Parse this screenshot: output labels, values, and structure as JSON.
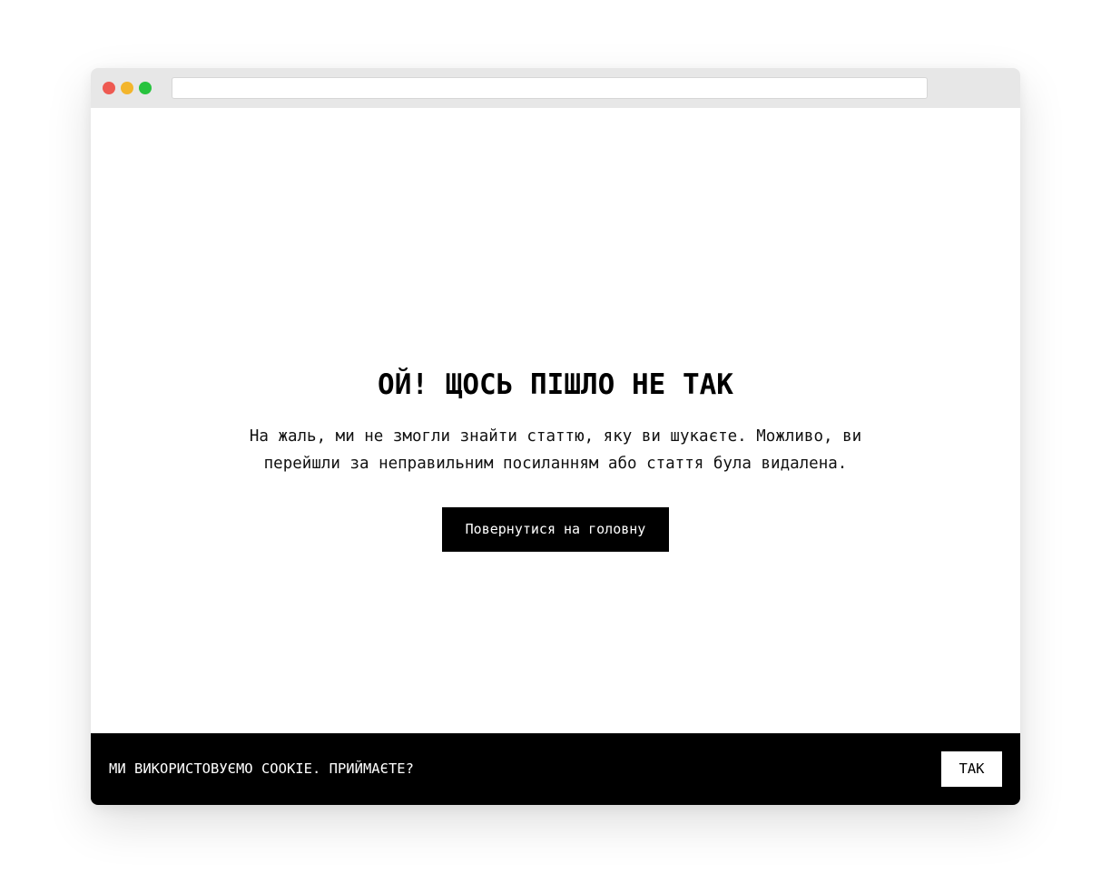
{
  "window": {
    "controls": {
      "close": {
        "icon": "close-dot-icon",
        "color": "#ee5a52"
      },
      "minimize": {
        "icon": "minimize-dot-icon",
        "color": "#f3b52c"
      },
      "maximize": {
        "icon": "maximize-dot-icon",
        "color": "#27c33e"
      }
    },
    "address_bar": {
      "value": ""
    }
  },
  "error": {
    "title": "ОЙ! ЩОСЬ ПІШЛО НЕ ТАК",
    "message": "На жаль, ми не змогли знайти статтю, яку ви шукаєте. Можливо, ви перейшли за неправильним посиланням або стаття була видалена.",
    "button_label": "Повернутися на головну"
  },
  "cookie_banner": {
    "text": "МИ ВИКОРИСТОВУЄМО COOKIE. ПРИЙМАЄТЕ?",
    "accept_label": "ТАК"
  },
  "colors": {
    "button_background": "#000000",
    "button_text": "#ffffff",
    "cookie_banner_background": "#000000",
    "titlebar_background": "#e7e7e7"
  }
}
